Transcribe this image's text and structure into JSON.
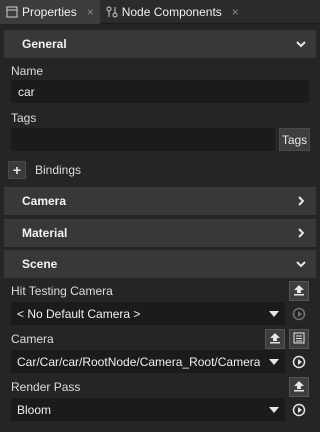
{
  "tabs": [
    {
      "label": "Properties",
      "close": "×",
      "icon": "panel-icon"
    },
    {
      "label": "Node Components",
      "close": "×",
      "icon": "components-icon"
    }
  ],
  "sections": {
    "general": "General",
    "camera": "Camera",
    "material": "Material",
    "scene": "Scene"
  },
  "fields": {
    "name_label": "Name",
    "name_value": "car",
    "tags_label": "Tags",
    "tags_value": "",
    "tags_button": "Tags",
    "bindings_add": "+",
    "bindings_label": "Bindings",
    "hit_testing_camera_label": "Hit Testing Camera",
    "hit_testing_camera_value": "< No Default Camera >",
    "camera_label": "Camera",
    "camera_value": "Car/Car/car/RootNode/Camera_Root/Camera",
    "render_pass_label": "Render Pass",
    "render_pass_value": "Bloom"
  },
  "colors": {
    "background": "#252526",
    "section_header": "#383838",
    "input_background": "#1b1b1b",
    "text": "#e6e6e6"
  }
}
